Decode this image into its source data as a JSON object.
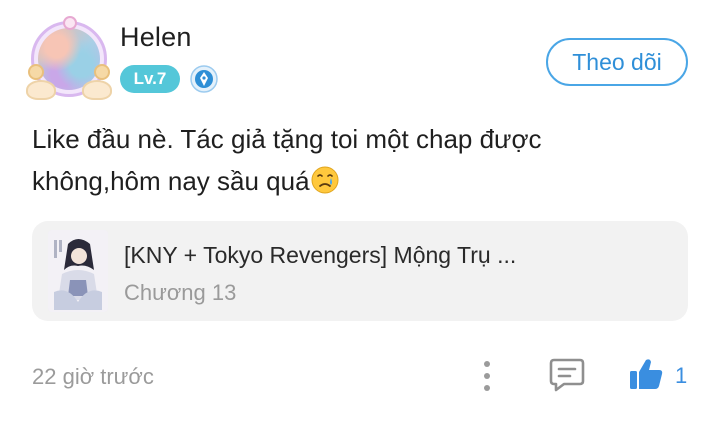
{
  "user": {
    "name": "Helen",
    "level": "Lv.7",
    "level_badge_color": "#54c7d9",
    "vip_badge_icon": "diamond-badge-icon"
  },
  "follow_button": {
    "label": "Theo dõi",
    "color": "#2f8fd8"
  },
  "comment": {
    "text": "Like đầu nè. Tác giả tặng toi một chap được không,hôm nay sầu quá",
    "emoji": "sad-tear-emoji"
  },
  "story_card": {
    "title": "[KNY + Tokyo Revengers] Mộng Trụ ...",
    "chapter": "Chương 13",
    "cover_icon": "story-cover-image"
  },
  "footer": {
    "timestamp": "22 giờ trước",
    "more_icon": "more-vertical-icon",
    "reply_icon": "comment-icon",
    "like_icon": "thumbs-up-icon",
    "like_count": "1",
    "like_color": "#3a8ee0"
  }
}
